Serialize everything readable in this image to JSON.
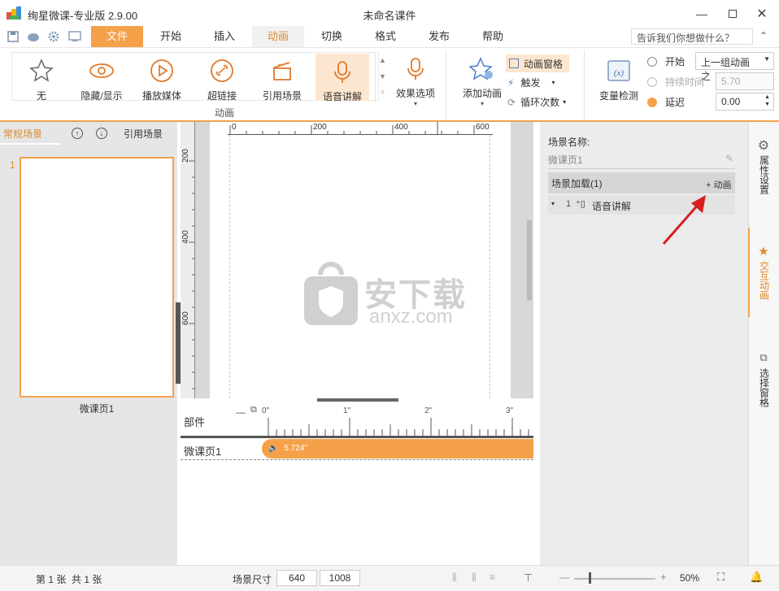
{
  "titlebar": {
    "app_title": "绚星微课-专业版 2.9.00",
    "doc_title": "未命名课件"
  },
  "menu": {
    "file": "文件",
    "start": "开始",
    "insert": "插入",
    "animation": "动画",
    "transition": "切换",
    "format": "格式",
    "publish": "发布",
    "help": "帮助"
  },
  "help_search": {
    "placeholder": "告诉我们你想做什么？"
  },
  "ribbon": {
    "none": "无",
    "hide_show": "隐藏/显示",
    "play_media": "播放媒体",
    "hyperlink": "超链接",
    "ref_scene": "引用场景",
    "voice": "语音讲解",
    "effect_options": "效果选项",
    "group_label": "动画",
    "add_anim": "添加动画",
    "anim_pane": "动画窗格",
    "trigger": "触发",
    "loop": "循环次数",
    "var_detect": "变量检测",
    "start_label": "开始",
    "start_value": "上一组动画之",
    "duration_label": "持续时间",
    "duration_value": "5.70",
    "delay_label": "延迟",
    "delay_value": "0.00"
  },
  "left_panel": {
    "tab_normal": "常规场景",
    "tab_ref": "引用场景",
    "slide_number": "1",
    "slide_name": "微课页1"
  },
  "ruler": {
    "h": [
      "0",
      "200",
      "400",
      "600"
    ],
    "v": [
      "200",
      "400",
      "600"
    ]
  },
  "watermark": {
    "cn": "安下载",
    "en": "anxz.com"
  },
  "timeline": {
    "parts_label": "部件",
    "ticks": [
      "0\"",
      "1\"",
      "2\"",
      "3\""
    ],
    "track_label": "微课页1",
    "clip_value": "5.724\""
  },
  "right_panel": {
    "scene_name_label": "场景名称:",
    "scene_name": "微课页1",
    "scene_load": "场景加载(1)",
    "add_anim": "+ 动画",
    "row_index": "1",
    "row_label": "语音讲解"
  },
  "side_tabs": {
    "props": "属性设置",
    "interactive": "交互动画",
    "selection": "选择窗格"
  },
  "status": {
    "page_info": "第 1 张  共 1 张",
    "size_label": "场景尺寸",
    "width": "640",
    "height": "1008",
    "zoom": "50%"
  },
  "colors": {
    "accent": "#f5a14a",
    "arrow": "#d81e1e"
  }
}
